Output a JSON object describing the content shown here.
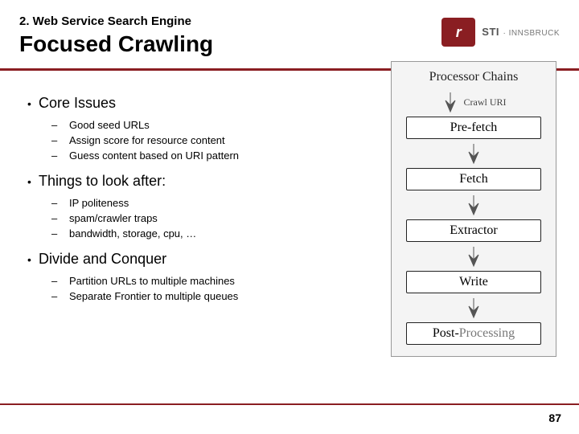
{
  "header": {
    "section": "2. Web Service Search Engine",
    "title": "Focused Crawling"
  },
  "logo": {
    "glyph": "r",
    "brand": "STI",
    "sub": "· INNSBRUCK"
  },
  "bullets": [
    {
      "head": "Core Issues",
      "subs": [
        "Good seed URLs",
        "Assign score for resource content",
        "Guess content based on URI pattern"
      ]
    },
    {
      "head": "Things to look after:",
      "subs": [
        "IP politeness",
        "spam/crawler traps",
        "bandwidth, storage, cpu, …"
      ]
    },
    {
      "head": "Divide and Conquer",
      "subs": [
        "Partition URLs to multiple machines",
        "Separate Frontier to multiple queues"
      ]
    }
  ],
  "chain": {
    "title": "Processor Chains",
    "crawl_label": "Crawl URI",
    "stages": [
      "Pre-fetch",
      "Fetch",
      "Extractor",
      "Write",
      "Post-"
    ],
    "post_suffix": "Processing"
  },
  "page": "87"
}
